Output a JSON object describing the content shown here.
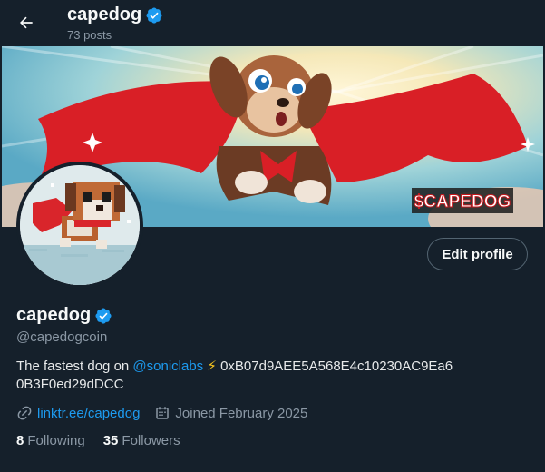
{
  "header": {
    "name": "capedog",
    "posts": "73 posts"
  },
  "banner": {
    "badge_text": "$CAPEDOG"
  },
  "profile": {
    "name": "capedog",
    "handle": "@capedogcoin",
    "edit_label": "Edit profile",
    "bio_prefix": "The fastest dog on ",
    "bio_mention": "@soniclabs",
    "bio_bolt": "⚡",
    "bio_suffix": " 0xB07d9AEE5A568E4c10230AC9Ea6 0B3F0ed29dDCC",
    "link": "linktr.ee/capedog",
    "joined": "Joined February 2025",
    "following_count": "8",
    "following_label": "Following",
    "followers_count": "35",
    "followers_label": "Followers"
  },
  "icons": {
    "back": "arrow-left-icon",
    "verified": "verified-badge-icon",
    "link": "link-icon",
    "calendar": "calendar-icon"
  },
  "colors": {
    "background": "#15202b",
    "accent": "#1d9bf0",
    "muted": "#8b98a5",
    "cape": "#e3262b"
  }
}
